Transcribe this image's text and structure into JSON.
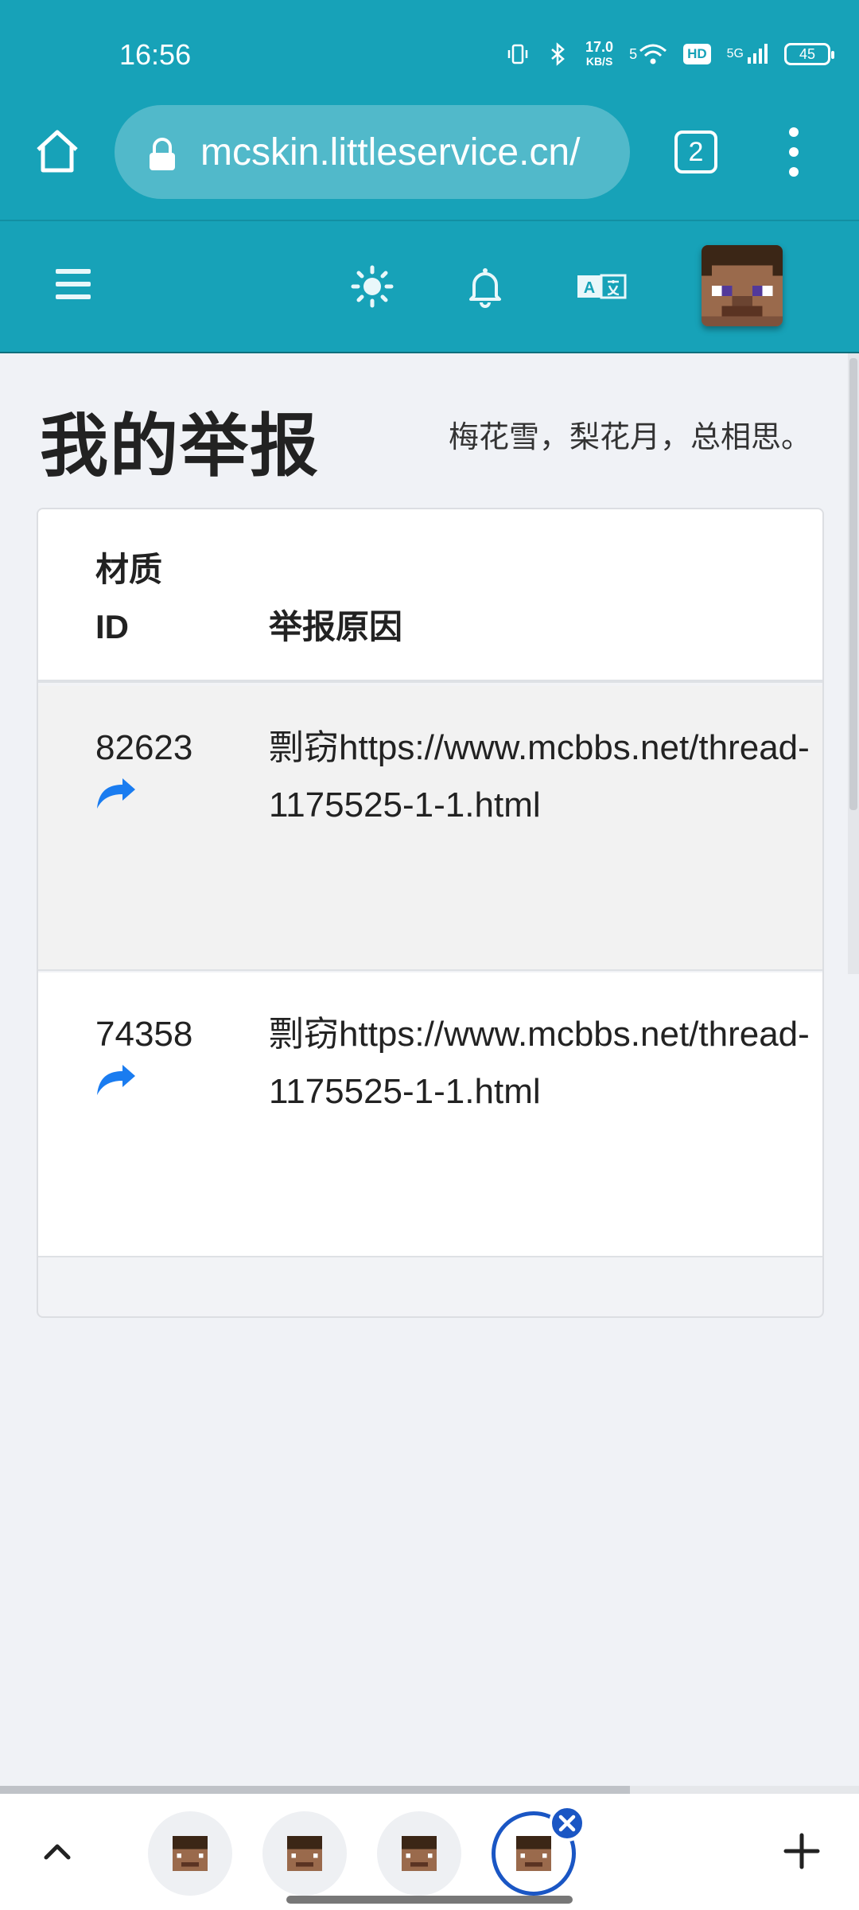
{
  "status_bar": {
    "time": "16:56",
    "net_speed_value": "17.0",
    "net_speed_unit": "KB/S",
    "wifi_label": "5",
    "hd_label": "HD",
    "cell_label": "5G",
    "battery": "45"
  },
  "browser": {
    "url": "mcskin.littleservice.cn/",
    "tab_count": "2"
  },
  "navbar": {
    "icons": [
      "menu-icon",
      "theme-icon",
      "bell-icon",
      "translate-icon",
      "avatar"
    ]
  },
  "page": {
    "title": "我的举报",
    "subtitle": "梅花雪，梨花月，总相思。"
  },
  "table": {
    "header_id": "材质ID",
    "header_reason": "举报原因",
    "rows": [
      {
        "id": "82623",
        "reason": "剽窃https://www.mcbbs.net/thread-1175525-1-1.html"
      },
      {
        "id": "74358",
        "reason": "剽窃https://www.mcbbs.net/thread-1175525-1-1.html"
      }
    ]
  },
  "colors": {
    "primary": "#17a2b8",
    "link_arrow": "#1a7cf0",
    "active_tab": "#1a56c4"
  }
}
